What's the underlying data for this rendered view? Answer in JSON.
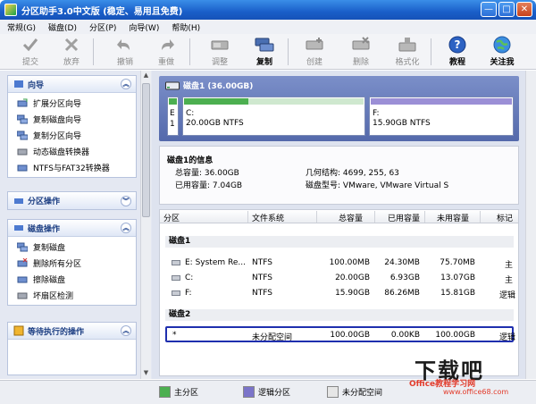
{
  "window": {
    "title": "分区助手3.0中文版 (稳定、易用且免费)",
    "controls": [
      "—",
      "□",
      "✕"
    ]
  },
  "menu": [
    "常规(G)",
    "磁盘(D)",
    "分区(P)",
    "向导(W)",
    "帮助(H)"
  ],
  "toolbar": {
    "items": [
      {
        "label": "提交",
        "icon": "check-icon",
        "enabled": false
      },
      {
        "label": "放弃",
        "icon": "discard-icon",
        "enabled": false
      },
      {
        "label": "撤销",
        "icon": "undo-icon",
        "enabled": false
      },
      {
        "label": "重做",
        "icon": "redo-icon",
        "enabled": false
      },
      {
        "label": "调整",
        "icon": "resize-icon",
        "enabled": false
      },
      {
        "label": "复制",
        "icon": "copy-disk-icon",
        "enabled": true
      },
      {
        "label": "创建",
        "icon": "create-icon",
        "enabled": false
      },
      {
        "label": "删除",
        "icon": "delete-icon",
        "enabled": false
      },
      {
        "label": "格式化",
        "icon": "format-icon",
        "enabled": false
      },
      {
        "label": "教程",
        "icon": "help-icon",
        "enabled": true
      },
      {
        "label": "关注我",
        "icon": "globe-icon",
        "enabled": true
      }
    ]
  },
  "sidebar": {
    "wizard": {
      "title": "向导",
      "items": [
        "扩展分区向导",
        "复制磁盘向导",
        "复制分区向导",
        "动态磁盘转换器",
        "NTFS与FAT32转换器"
      ]
    },
    "partition_ops": {
      "title": "分区操作"
    },
    "disk_ops": {
      "title": "磁盘操作",
      "items": [
        "复制磁盘",
        "删除所有分区",
        "擦除磁盘",
        "坏扇区检测"
      ]
    },
    "pending": {
      "title": "等待执行的操作"
    }
  },
  "disk_map": {
    "title": "磁盘1 (36.00GB)",
    "partitions": [
      {
        "letter": "E",
        "line2": "1",
        "name": "",
        "size": "",
        "color": "#4caf50",
        "used_fraction": 1.0
      },
      {
        "letter": "",
        "name": "C:",
        "size": "20.00GB NTFS",
        "color": "#4caf50",
        "used_fraction": 0.35
      },
      {
        "letter": "",
        "name": "F:",
        "size": "15.90GB NTFS",
        "color": "#9b8fd6",
        "used_fraction": 0.0
      }
    ]
  },
  "disk_info": {
    "title": "磁盘1的信息",
    "total_label": "总容量:",
    "total_value": "36.00GB",
    "used_label": "已用容量:",
    "used_value": "7.04GB",
    "geometry_label": "几何结构:",
    "geometry_value": "4699, 255, 63",
    "model_label": "磁盘型号:",
    "model_value": "VMware, VMware Virtual S"
  },
  "table": {
    "columns": [
      "分区",
      "文件系统",
      "总容量",
      "已用容量",
      "未用容量",
      "标记"
    ],
    "groups": [
      {
        "name": "磁盘1",
        "rows": [
          {
            "partition": "E:  System Re...",
            "fs": "NTFS",
            "total": "100.00MB",
            "used": "24.30MB",
            "free": "75.70MB",
            "flag": "主"
          },
          {
            "partition": "C:",
            "fs": "NTFS",
            "total": "20.00GB",
            "used": "6.93GB",
            "free": "13.07GB",
            "flag": "主"
          },
          {
            "partition": "F:",
            "fs": "NTFS",
            "total": "15.90GB",
            "used": "86.26MB",
            "free": "15.81GB",
            "flag": "逻辑"
          }
        ]
      },
      {
        "name": "磁盘2",
        "rows": [
          {
            "partition": "*",
            "fs": "未分配空间",
            "total": "100.00GB",
            "used": "0.00KB",
            "free": "100.00GB",
            "flag": "逻辑"
          }
        ]
      }
    ]
  },
  "status": {
    "legend": [
      {
        "label": "主分区",
        "color": "#4caf50"
      },
      {
        "label": "逻辑分区",
        "color": "#7b74c9"
      },
      {
        "label": "未分配空间",
        "color": "#e6e6e6"
      }
    ]
  },
  "watermark": {
    "big": "下载吧",
    "small": "Office教程学习网",
    "url": "www.office68.com"
  },
  "colors": {
    "accent": "#1a5fc9",
    "selection": "#1f2fae",
    "primary": "#4caf50",
    "logical": "#7b74c9"
  }
}
